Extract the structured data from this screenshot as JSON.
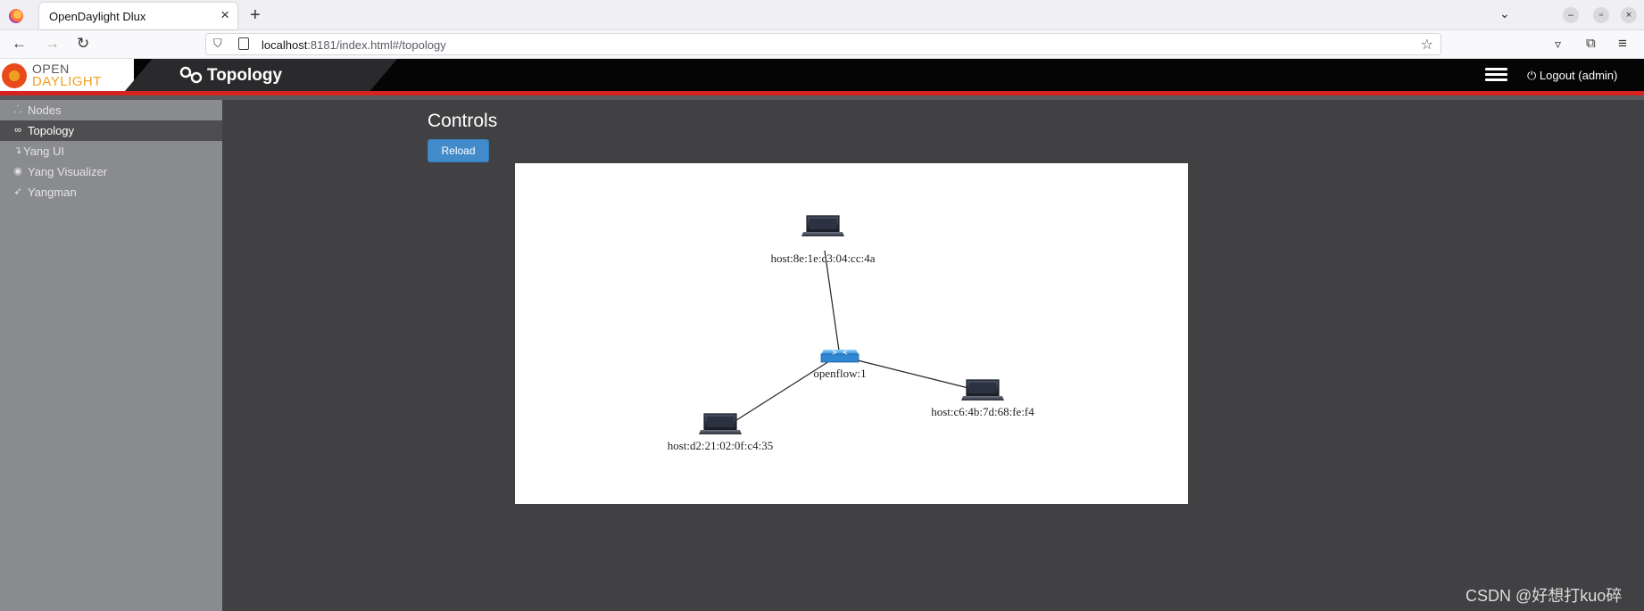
{
  "browser": {
    "tab_title": "OpenDaylight Dlux",
    "url_host": "localhost",
    "url_rest": ":8181/index.html#/topology"
  },
  "header": {
    "logo_top": "OPEN",
    "logo_bottom": "DAYLIGHT",
    "title": "Topology",
    "logout_label": "Logout (admin)"
  },
  "sidebar": {
    "items": [
      {
        "label": "Nodes",
        "icon": "sitemap-icon",
        "active": false
      },
      {
        "label": "Topology",
        "icon": "link-icon",
        "active": true
      },
      {
        "label": "Yang UI",
        "icon": "level-down-icon",
        "active": false
      },
      {
        "label": "Yang Visualizer",
        "icon": "eye-icon",
        "active": false
      },
      {
        "label": "Yangman",
        "icon": "rocket-icon",
        "active": false
      }
    ]
  },
  "main": {
    "controls_title": "Controls",
    "reload_label": "Reload"
  },
  "topology": {
    "nodes": [
      {
        "id": "openflow:1",
        "type": "switch"
      },
      {
        "id": "host:8e:1e:c3:04:cc:4a",
        "type": "host"
      },
      {
        "id": "host:c6:4b:7d:68:fe:f4",
        "type": "host"
      },
      {
        "id": "host:d2:21:02:0f:c4:35",
        "type": "host"
      }
    ],
    "links": [
      [
        "openflow:1",
        "host:8e:1e:c3:04:cc:4a"
      ],
      [
        "openflow:1",
        "host:c6:4b:7d:68:fe:f4"
      ],
      [
        "openflow:1",
        "host:d2:21:02:0f:c4:35"
      ]
    ]
  },
  "watermark": "CSDN @好想打kuo碎"
}
